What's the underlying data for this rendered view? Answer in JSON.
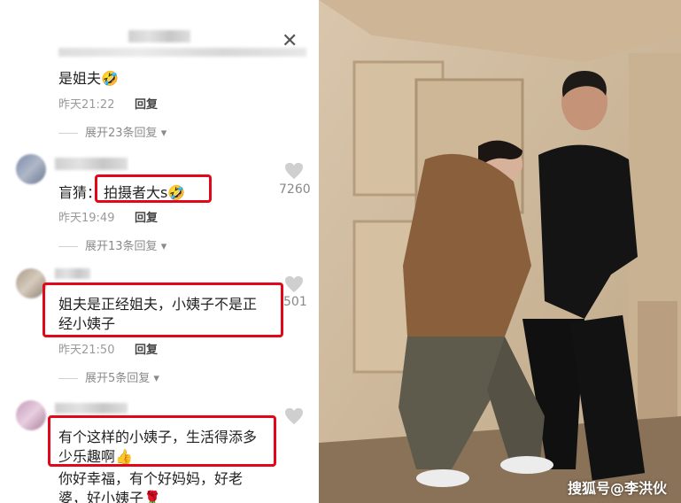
{
  "comments": [
    {
      "text_top_partial": "……",
      "text": "是姐夫🤣",
      "time": "昨天21:22",
      "reply": "回复",
      "expand": "展开23条回复"
    },
    {
      "text_prefix": "盲猜：",
      "text_highlight": "拍摄者大s🤣",
      "time": "昨天19:49",
      "reply": "回复",
      "expand": "展开13条回复",
      "likes": "7260"
    },
    {
      "text_line1": "姐夫是正经姐夫，小姨子不是正",
      "text_line2": "经小姨子",
      "time": "昨天21:50",
      "reply": "回复",
      "expand": "展开5条回复",
      "likes": "501"
    },
    {
      "text_line1": "有个这样的小姨子，生活得添多",
      "text_line2": "少乐趣啊👍",
      "text_line3": "你好幸福，有个好妈妈，好老",
      "text_line4": "婆，好小姨子🌹"
    }
  ],
  "watermark": "搜狐号@李洪伙",
  "colors": {
    "highlight_box": "#e3071a",
    "meta_text": "#9a9a9a"
  },
  "icons": [
    "close-icon",
    "heart-icon",
    "chevron-down-icon"
  ]
}
